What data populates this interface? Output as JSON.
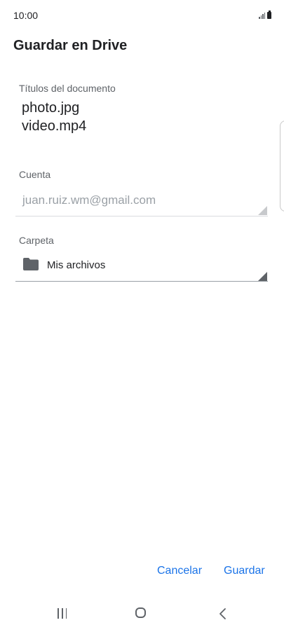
{
  "status_bar": {
    "time": "10:00",
    "icons": [
      "signal-icon",
      "battery-icon"
    ]
  },
  "dialog": {
    "title": "Guardar en Drive",
    "titles_label": "Títulos del documento",
    "documents": [
      "photo.jpg",
      "video.mp4"
    ],
    "account_label": "Cuenta",
    "account_value": "juan.ruiz.wm@gmail.com",
    "folder_label": "Carpeta",
    "folder_value": "Mis archivos"
  },
  "actions": {
    "cancel_label": "Cancelar",
    "save_label": "Guardar"
  },
  "nav": {
    "items": [
      "recents-icon",
      "home-icon",
      "back-icon"
    ]
  },
  "colors": {
    "accent": "#1a73e8",
    "text_primary": "#202124",
    "text_secondary": "#5f6368",
    "text_disabled": "#9aa0a6",
    "divider": "#dadce0"
  }
}
